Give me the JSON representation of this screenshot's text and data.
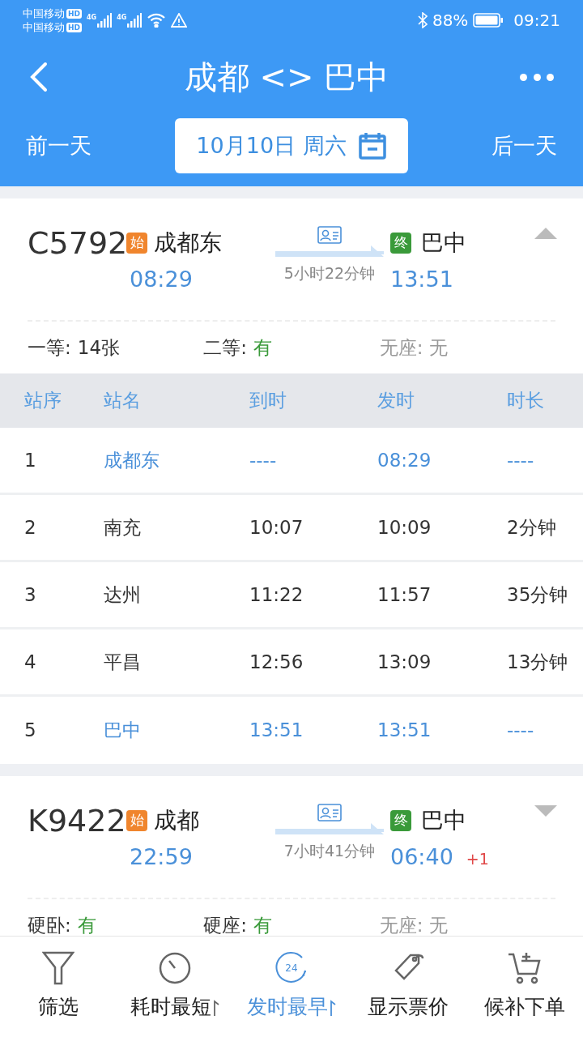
{
  "status_bar": {
    "carriers": [
      "中国移动",
      "中国移动"
    ],
    "hd": [
      "HD",
      "HD"
    ],
    "network": [
      "4G",
      "4G"
    ],
    "battery": "88%",
    "time": "09:21"
  },
  "header": {
    "title": "成都 <> 巴中"
  },
  "date_bar": {
    "prev": "前一天",
    "date": "10月10日 周六",
    "next": "后一天"
  },
  "trains": [
    {
      "number": "C5792",
      "start_badge": "始",
      "from": "成都东",
      "depart": "08:29",
      "duration": "5小时22分钟",
      "end_badge": "终",
      "to": "巴中",
      "arrive": "13:51",
      "expanded": true,
      "seats": [
        {
          "label": "一等:",
          "value": "14张",
          "kind": "count"
        },
        {
          "label": "二等:",
          "value": "有",
          "kind": "available"
        },
        {
          "label": "无座:",
          "value": "无",
          "kind": "none"
        }
      ],
      "stops": {
        "columns": [
          "站序",
          "站名",
          "到时",
          "发时",
          "时长"
        ],
        "rows": [
          {
            "cells": [
              "1",
              "成都东",
              "----",
              "08:29",
              "----"
            ],
            "highlighted": true
          },
          {
            "cells": [
              "2",
              "南充",
              "10:07",
              "10:09",
              "2分钟"
            ],
            "highlighted": false
          },
          {
            "cells": [
              "3",
              "达州",
              "11:22",
              "11:57",
              "35分钟"
            ],
            "highlighted": false
          },
          {
            "cells": [
              "4",
              "平昌",
              "12:56",
              "13:09",
              "13分钟"
            ],
            "highlighted": false
          },
          {
            "cells": [
              "5",
              "巴中",
              "13:51",
              "13:51",
              "----"
            ],
            "highlighted": true
          }
        ]
      }
    },
    {
      "number": "K9422",
      "start_badge": "始",
      "from": "成都",
      "depart": "22:59",
      "duration": "7小时41分钟",
      "end_badge": "终",
      "to": "巴中",
      "arrive": "06:40",
      "day_offset": "+1",
      "expanded": false,
      "seats": [
        {
          "label": "硬卧:",
          "value": "有",
          "kind": "available"
        },
        {
          "label": "硬座:",
          "value": "有",
          "kind": "available"
        },
        {
          "label": "无座:",
          "value": "无",
          "kind": "none"
        }
      ]
    }
  ],
  "bottom_tabs": [
    {
      "label": "筛选",
      "kind": "filter",
      "selected": false,
      "sortable": false
    },
    {
      "label": "耗时最短",
      "kind": "timer",
      "selected": false,
      "sortable": true
    },
    {
      "label": "发时最早",
      "kind": "clock24",
      "icon_text": "24",
      "selected": true,
      "sortable": true
    },
    {
      "label": "显示票价",
      "kind": "tag",
      "selected": false,
      "sortable": false
    },
    {
      "label": "候补下单",
      "kind": "cart",
      "selected": false,
      "sortable": false
    }
  ]
}
